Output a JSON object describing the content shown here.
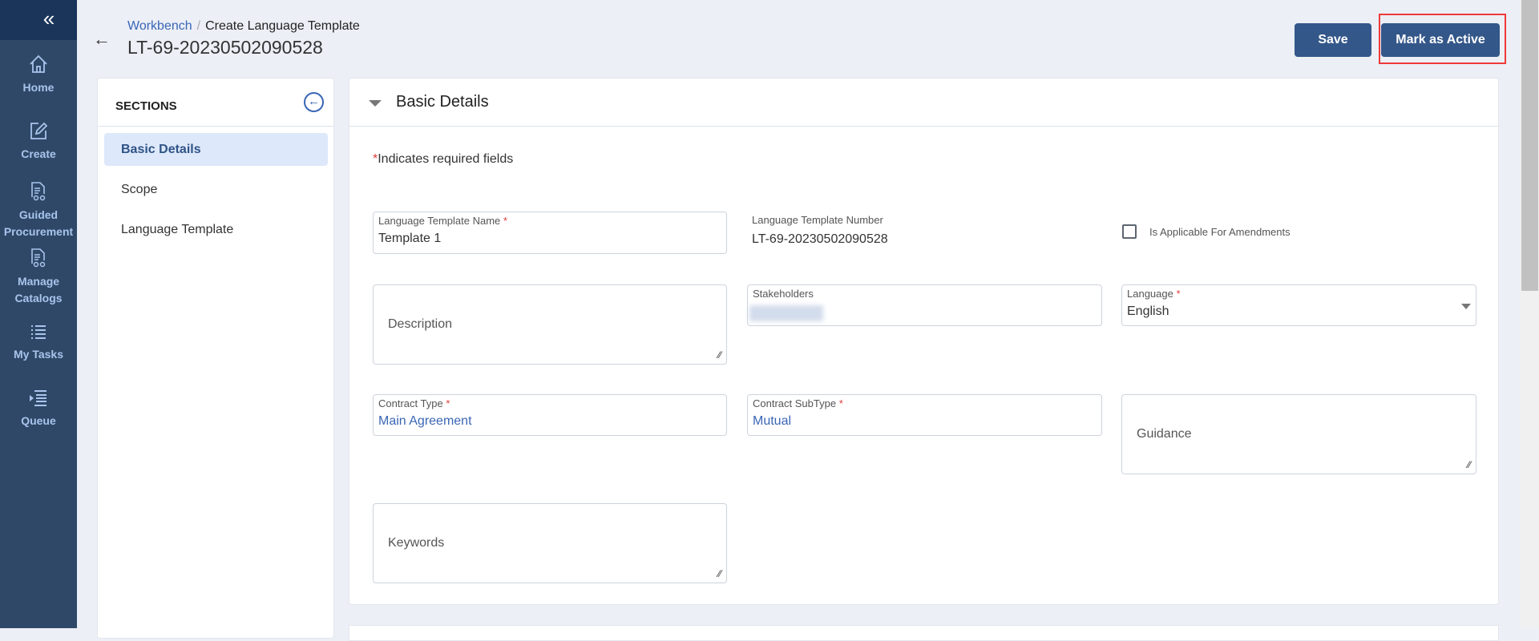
{
  "nav": {
    "collapse_icon": "double-chevron-left",
    "items": [
      {
        "label": "Home",
        "icon": "home-icon"
      },
      {
        "label": "Create",
        "icon": "edit-icon"
      },
      {
        "label": "Guided Procurement",
        "icon": "document-link-icon"
      },
      {
        "label": "Manage Catalogs",
        "icon": "document-link-icon"
      },
      {
        "label": "My Tasks",
        "icon": "list-icon"
      },
      {
        "label": "Queue",
        "icon": "queue-icon"
      }
    ]
  },
  "header": {
    "breadcrumb": {
      "parent": "Workbench",
      "separator": "/",
      "current": "Create Language Template"
    },
    "title": "LT-69-20230502090528",
    "save": "Save",
    "mark_active": "Mark as Active"
  },
  "sections": {
    "title": "SECTIONS",
    "items": [
      "Basic Details",
      "Scope",
      "Language Template"
    ],
    "active": "Basic Details"
  },
  "main": {
    "title": "Basic Details",
    "required_note_star": "*",
    "required_note": "Indicates required fields",
    "fields": {
      "name": {
        "label": "Language Template Name",
        "required": "*",
        "value": "Template 1"
      },
      "number": {
        "label": "Language Template Number",
        "value": "LT-69-20230502090528"
      },
      "amendments": {
        "label": "Is Applicable For Amendments",
        "checked": false
      },
      "description": {
        "placeholder": "Description"
      },
      "stakeholders": {
        "label": "Stakeholders"
      },
      "language": {
        "label": "Language",
        "required": "*",
        "value": "English"
      },
      "contract_type": {
        "label": "Contract Type",
        "required": "*",
        "value": "Main Agreement"
      },
      "contract_subtype": {
        "label": "Contract SubType",
        "required": "*",
        "value": "Mutual"
      },
      "guidance": {
        "placeholder": "Guidance"
      },
      "keywords": {
        "placeholder": "Keywords"
      }
    }
  },
  "colors": {
    "nav": "#2f4868",
    "accent": "#34578a",
    "link": "#3a66b5",
    "highlight": "#f03a3a"
  }
}
